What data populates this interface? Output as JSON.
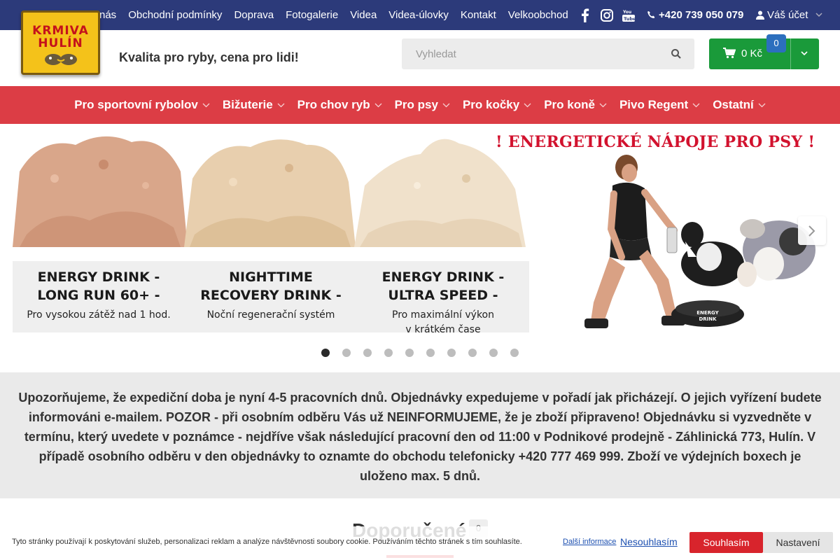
{
  "topbar": {
    "nav": [
      "nás",
      "Obchodní podmínky",
      "Doprava",
      "Fotogalerie",
      "Videa",
      "Videa-úlovky",
      "Kontakt",
      "Velkoobchod"
    ],
    "social_icons": [
      "facebook-icon",
      "instagram-icon",
      "youtube-icon"
    ],
    "phone": "+420 739 050 079",
    "account": "Váš účet",
    "bg_color": "#2c3a7a"
  },
  "logo": {
    "line1": "KRMIVA",
    "line2": "HULÍN"
  },
  "header": {
    "tagline": "Kvalita pro ryby, cena pro lidi!"
  },
  "search": {
    "placeholder": "Vyhledat"
  },
  "cart": {
    "amount": "0 Kč",
    "count": "0",
    "color": "#1a9a3a"
  },
  "categories": [
    "Pro sportovní rybolov",
    "Bižuterie",
    "Pro chov ryb",
    "Pro psy",
    "Pro kočky",
    "Pro koně",
    "Pivo Regent",
    "Ostatní"
  ],
  "banner": {
    "headline": "! ENERGETICKÉ NÁPOJE PRO PSY !",
    "products": [
      {
        "title1": "ENERGY DRINK -",
        "title2": "LONG RUN 60+ -",
        "sub1": "Pro vysokou zátěž nad 1 hod.",
        "sub2": ""
      },
      {
        "title1": "NIGHTTIME",
        "title2": "RECOVERY DRINK -",
        "sub1": "Noční regenerační systém",
        "sub2": ""
      },
      {
        "title1": "ENERGY DRINK -",
        "title2": "ULTRA SPEED -",
        "sub1": "Pro maximální výkon",
        "sub2": "v krátkém čase"
      }
    ],
    "bowl_label1": "ENERGY",
    "bowl_label2": "DRINK",
    "slide_count": 10,
    "active_slide": 1
  },
  "notice": {
    "text": "Upozorňujeme, že expediční doba je nyní 4-5 pracovních dnů. Objednávky expedujeme v pořadí jak přicházejí. O jejich vyřízení budete informováni e-mailem. POZOR - při osobním odběru Vás už NEINFORMUJEME, že je zboží připraveno! Objednávku si vyzvedněte v termínu, který uvedete v poznámce - nejdříve však následující pracovní den od 11:00 v Podnikové prodejně - Záhlinická 773, Hulín. V případě osobního odběru v den objednávky to oznamte do obchodu telefonicky +420 777 469 999. Zboží ve výdejních boxech je uloženo max. 5 dnů."
  },
  "recommended": {
    "title": "Doporučené",
    "count": "0"
  },
  "cookie": {
    "text": "Tyto stránky používají k poskytování služeb, personalizaci reklam a analýze návštěvnosti soubory cookie. Používáním těchto stránek s tím souhlasíte.",
    "more": "Další informace",
    "decline": "Nesouhlasím",
    "accept": "Souhlasím",
    "settings": "Nastavení"
  }
}
